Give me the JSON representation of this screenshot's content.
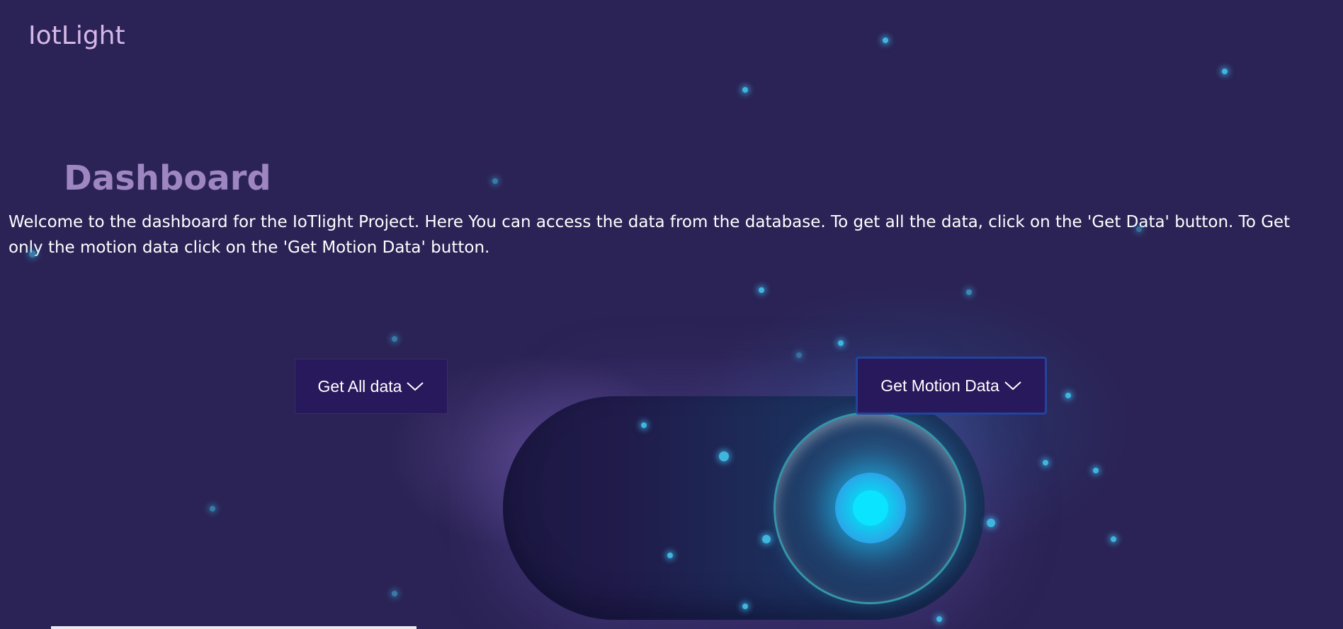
{
  "app": {
    "brand": "IotLight"
  },
  "dashboard": {
    "title": "Dashboard",
    "intro": "Welcome to the dashboard for the IoTlight Project. Here You can access the data from the database. To get all the data, click on the 'Get Data' button. To Get only the motion data click on the 'Get Motion Data' button."
  },
  "buttons": {
    "get_all_label": "Get All data",
    "get_motion_label": "Get Motion Data"
  },
  "colors": {
    "background": "#2b2355",
    "brand_text": "#d6b8e8",
    "heading": "#9e86c2",
    "button_bg": "#28185c",
    "button_focus_border": "#23449c",
    "glow_cyan": "#0be4ff"
  },
  "icons": {
    "dropdown": "chevron-down-icon"
  }
}
